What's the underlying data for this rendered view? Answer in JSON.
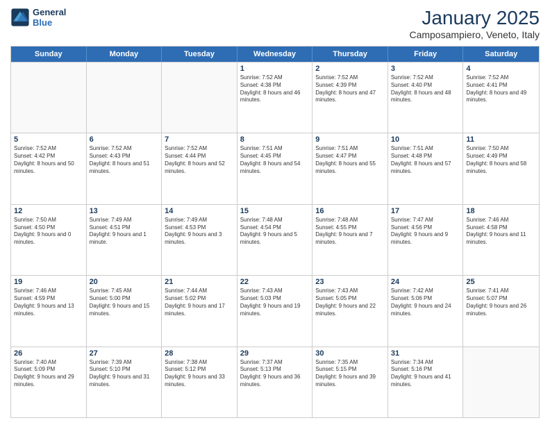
{
  "logo": {
    "line1": "General",
    "line2": "Blue"
  },
  "title": "January 2025",
  "location": "Camposampiero, Veneto, Italy",
  "days_of_week": [
    "Sunday",
    "Monday",
    "Tuesday",
    "Wednesday",
    "Thursday",
    "Friday",
    "Saturday"
  ],
  "weeks": [
    [
      {
        "day": "",
        "empty": true
      },
      {
        "day": "",
        "empty": true
      },
      {
        "day": "",
        "empty": true
      },
      {
        "day": "1",
        "sunrise": "7:52 AM",
        "sunset": "4:38 PM",
        "daylight": "8 hours and 46 minutes."
      },
      {
        "day": "2",
        "sunrise": "7:52 AM",
        "sunset": "4:39 PM",
        "daylight": "8 hours and 47 minutes."
      },
      {
        "day": "3",
        "sunrise": "7:52 AM",
        "sunset": "4:40 PM",
        "daylight": "8 hours and 48 minutes."
      },
      {
        "day": "4",
        "sunrise": "7:52 AM",
        "sunset": "4:41 PM",
        "daylight": "8 hours and 49 minutes."
      }
    ],
    [
      {
        "day": "5",
        "sunrise": "7:52 AM",
        "sunset": "4:42 PM",
        "daylight": "8 hours and 50 minutes."
      },
      {
        "day": "6",
        "sunrise": "7:52 AM",
        "sunset": "4:43 PM",
        "daylight": "8 hours and 51 minutes."
      },
      {
        "day": "7",
        "sunrise": "7:52 AM",
        "sunset": "4:44 PM",
        "daylight": "8 hours and 52 minutes."
      },
      {
        "day": "8",
        "sunrise": "7:51 AM",
        "sunset": "4:45 PM",
        "daylight": "8 hours and 54 minutes."
      },
      {
        "day": "9",
        "sunrise": "7:51 AM",
        "sunset": "4:47 PM",
        "daylight": "8 hours and 55 minutes."
      },
      {
        "day": "10",
        "sunrise": "7:51 AM",
        "sunset": "4:48 PM",
        "daylight": "8 hours and 57 minutes."
      },
      {
        "day": "11",
        "sunrise": "7:50 AM",
        "sunset": "4:49 PM",
        "daylight": "8 hours and 58 minutes."
      }
    ],
    [
      {
        "day": "12",
        "sunrise": "7:50 AM",
        "sunset": "4:50 PM",
        "daylight": "9 hours and 0 minutes."
      },
      {
        "day": "13",
        "sunrise": "7:49 AM",
        "sunset": "4:51 PM",
        "daylight": "9 hours and 1 minute."
      },
      {
        "day": "14",
        "sunrise": "7:49 AM",
        "sunset": "4:53 PM",
        "daylight": "9 hours and 3 minutes."
      },
      {
        "day": "15",
        "sunrise": "7:48 AM",
        "sunset": "4:54 PM",
        "daylight": "9 hours and 5 minutes."
      },
      {
        "day": "16",
        "sunrise": "7:48 AM",
        "sunset": "4:55 PM",
        "daylight": "9 hours and 7 minutes."
      },
      {
        "day": "17",
        "sunrise": "7:47 AM",
        "sunset": "4:56 PM",
        "daylight": "9 hours and 9 minutes."
      },
      {
        "day": "18",
        "sunrise": "7:46 AM",
        "sunset": "4:58 PM",
        "daylight": "9 hours and 11 minutes."
      }
    ],
    [
      {
        "day": "19",
        "sunrise": "7:46 AM",
        "sunset": "4:59 PM",
        "daylight": "9 hours and 13 minutes."
      },
      {
        "day": "20",
        "sunrise": "7:45 AM",
        "sunset": "5:00 PM",
        "daylight": "9 hours and 15 minutes."
      },
      {
        "day": "21",
        "sunrise": "7:44 AM",
        "sunset": "5:02 PM",
        "daylight": "9 hours and 17 minutes."
      },
      {
        "day": "22",
        "sunrise": "7:43 AM",
        "sunset": "5:03 PM",
        "daylight": "9 hours and 19 minutes."
      },
      {
        "day": "23",
        "sunrise": "7:43 AM",
        "sunset": "5:05 PM",
        "daylight": "9 hours and 22 minutes."
      },
      {
        "day": "24",
        "sunrise": "7:42 AM",
        "sunset": "5:06 PM",
        "daylight": "9 hours and 24 minutes."
      },
      {
        "day": "25",
        "sunrise": "7:41 AM",
        "sunset": "5:07 PM",
        "daylight": "9 hours and 26 minutes."
      }
    ],
    [
      {
        "day": "26",
        "sunrise": "7:40 AM",
        "sunset": "5:09 PM",
        "daylight": "9 hours and 29 minutes."
      },
      {
        "day": "27",
        "sunrise": "7:39 AM",
        "sunset": "5:10 PM",
        "daylight": "9 hours and 31 minutes."
      },
      {
        "day": "28",
        "sunrise": "7:38 AM",
        "sunset": "5:12 PM",
        "daylight": "9 hours and 33 minutes."
      },
      {
        "day": "29",
        "sunrise": "7:37 AM",
        "sunset": "5:13 PM",
        "daylight": "9 hours and 36 minutes."
      },
      {
        "day": "30",
        "sunrise": "7:35 AM",
        "sunset": "5:15 PM",
        "daylight": "9 hours and 39 minutes."
      },
      {
        "day": "31",
        "sunrise": "7:34 AM",
        "sunset": "5:16 PM",
        "daylight": "9 hours and 41 minutes."
      },
      {
        "day": "",
        "empty": true
      }
    ]
  ]
}
